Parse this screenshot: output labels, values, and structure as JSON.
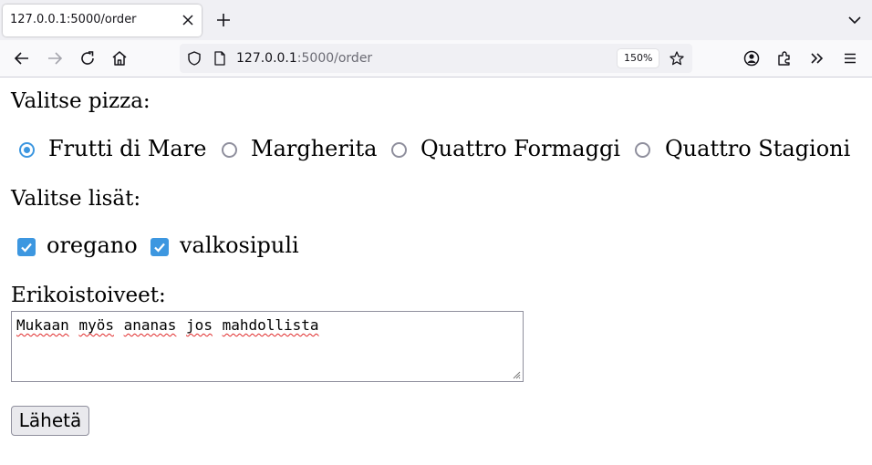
{
  "browser": {
    "tab_title": "127.0.0.1:5000/order",
    "url_host": "127.0.0.1",
    "url_path": ":5000/order",
    "zoom": "150%"
  },
  "form": {
    "pizza_label": "Valitse pizza:",
    "pizzas": [
      {
        "label": "Frutti di Mare",
        "selected": true
      },
      {
        "label": "Margherita",
        "selected": false
      },
      {
        "label": "Quattro Formaggi",
        "selected": false
      },
      {
        "label": "Quattro Stagioni",
        "selected": false
      }
    ],
    "extras_label": "Valitse lisät:",
    "extras": [
      {
        "label": "oregano",
        "checked": true
      },
      {
        "label": "valkosipuli",
        "checked": true
      }
    ],
    "requests_label": "Erikoistoiveet:",
    "requests_words": [
      "Mukaan",
      "myös",
      "ananas",
      "jos",
      "mahdollista"
    ],
    "submit_label": "Lähetä"
  },
  "colors": {
    "accent": "#3d97e0",
    "chrome_bg": "#f0f0f4",
    "spellcheck": "#e02a2a"
  },
  "icons": [
    "close-icon",
    "plus-icon",
    "chevron-down-icon",
    "back-arrow-icon",
    "forward-arrow-icon",
    "reload-icon",
    "home-icon",
    "shield-icon",
    "page-icon",
    "star-icon",
    "account-icon",
    "extensions-icon",
    "overflow-icon",
    "menu-icon",
    "resize-grip-icon"
  ]
}
